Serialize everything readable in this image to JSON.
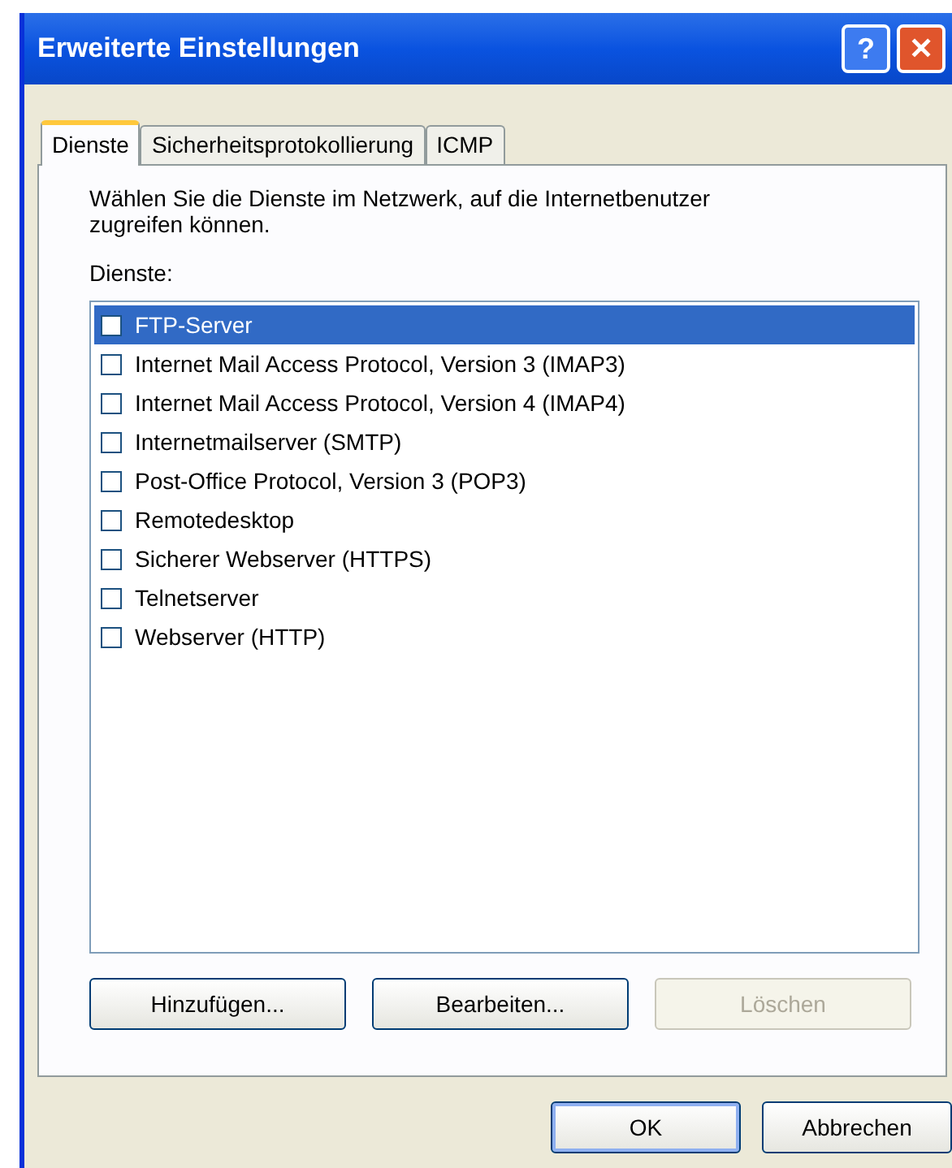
{
  "window": {
    "title": "Erweiterte Einstellungen",
    "title_buttons": [
      "?",
      "✕"
    ]
  },
  "tabs": [
    {
      "label": "Dienste",
      "selected": true
    },
    {
      "label": "Sicherheitsprotokollierung",
      "selected": false
    },
    {
      "label": "ICMP",
      "selected": false
    }
  ],
  "description": "Wählen Sie die Dienste im Netzwerk, auf die Internetbenutzer zugreifen können.",
  "services_label": "Dienste:",
  "services": [
    {
      "name": "FTP-Server",
      "checked": false,
      "selected": true
    },
    {
      "name": "Internet Mail Access Protocol, Version 3 (IMAP3)",
      "checked": false,
      "selected": false
    },
    {
      "name": "Internet Mail Access Protocol, Version 4 (IMAP4)",
      "checked": false,
      "selected": false
    },
    {
      "name": "Internetmailserver (SMTP)",
      "checked": false,
      "selected": false
    },
    {
      "name": "Post-Office Protocol, Version 3 (POP3)",
      "checked": false,
      "selected": false
    },
    {
      "name": "Remotedesktop",
      "checked": false,
      "selected": false
    },
    {
      "name": "Sicherer Webserver (HTTPS)",
      "checked": false,
      "selected": false
    },
    {
      "name": "Telnetserver",
      "checked": false,
      "selected": false
    },
    {
      "name": "Webserver (HTTP)",
      "checked": false,
      "selected": false
    }
  ],
  "list_buttons": [
    {
      "label": "Hinzufügen...",
      "disabled": false
    },
    {
      "label": "Bearbeiten...",
      "disabled": false
    },
    {
      "label": "Löschen",
      "disabled": true
    }
  ],
  "dialog_buttons": [
    {
      "label": "OK",
      "default": true
    },
    {
      "label": "Abbrechen",
      "default": false
    }
  ]
}
